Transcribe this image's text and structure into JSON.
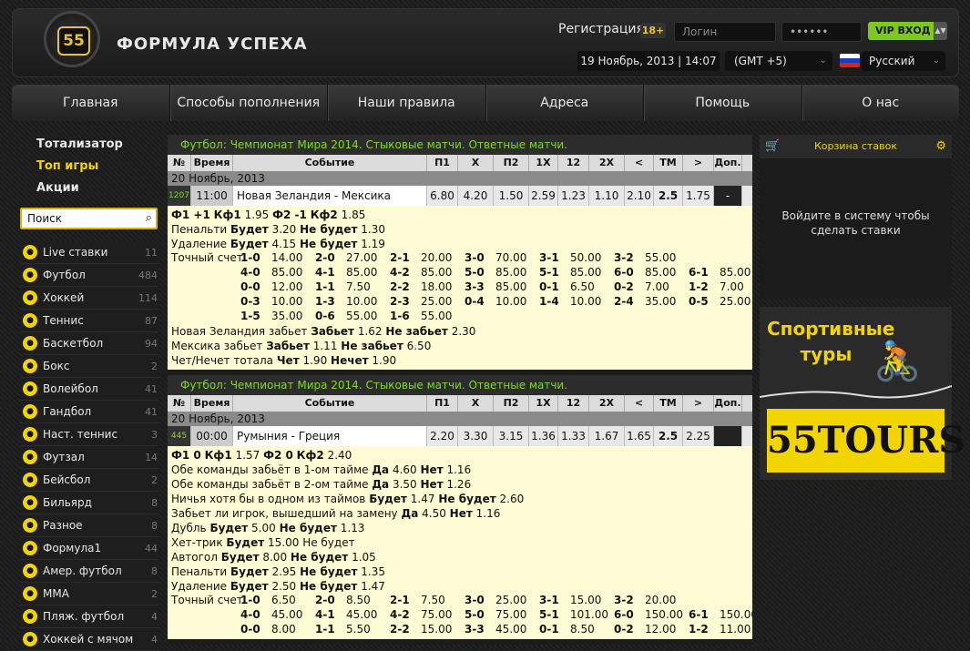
{
  "header": {
    "logo_number": "55",
    "logo_text": "ФОРМУЛА УСПЕХА",
    "register": "Регистрация",
    "age_badge": "18+",
    "login_placeholder": "Логин",
    "password_value": "••••••",
    "vip_label": "VIP ВХОД",
    "datetime": "19 Ноябрь, 2013 | 14:07",
    "timezone": "(GMT +5)",
    "language": "Русский",
    "accent": "#f2d400",
    "green": "#7ddc24"
  },
  "nav": [
    "Главная",
    "Способы пополнения",
    "Наши правила",
    "Адреса",
    "Помощь",
    "О нас"
  ],
  "sidebar": {
    "top": [
      "Тотализатор",
      "Топ игры",
      "Акции"
    ],
    "search_placeholder": "Поиск",
    "sports": [
      {
        "name": "Live ставки",
        "count": "11"
      },
      {
        "name": "Футбол",
        "count": "484"
      },
      {
        "name": "Хоккей",
        "count": "114"
      },
      {
        "name": "Теннис",
        "count": "87"
      },
      {
        "name": "Баскетбол",
        "count": "94"
      },
      {
        "name": "Бокс",
        "count": "2"
      },
      {
        "name": "Волейбол",
        "count": "41"
      },
      {
        "name": "Гандбол",
        "count": "41"
      },
      {
        "name": "Наст. теннис",
        "count": "3"
      },
      {
        "name": "Футзал",
        "count": "14"
      },
      {
        "name": "Бейсбол",
        "count": "2"
      },
      {
        "name": "Бильярд",
        "count": "8"
      },
      {
        "name": "Разное",
        "count": "8"
      },
      {
        "name": "Формула1",
        "count": "44"
      },
      {
        "name": "Амер. футбол",
        "count": "8"
      },
      {
        "name": "MMA",
        "count": "2"
      },
      {
        "name": "Пляж. футбол",
        "count": "4"
      },
      {
        "name": "Хоккей с мячом",
        "count": "4"
      }
    ]
  },
  "table_headers": [
    "№",
    "Время",
    "Событие",
    "П1",
    "Х",
    "П2",
    "1Х",
    "12",
    "2Х",
    "<",
    "ТМ",
    ">",
    "Доп."
  ],
  "matches": [
    {
      "section": "Футбол: Чемпионат Мира 2014. Стыковые матчи. Ответные матчи.",
      "date": "20 Ноябрь, 2013",
      "id": "1207",
      "time": "11:00",
      "event": "Новая Зеландия - Мексика",
      "odds": [
        "6.80",
        "4.20",
        "1.50",
        "2.59",
        "1.23",
        "1.10",
        "2.10",
        "2.5",
        "1.75"
      ],
      "extra": "-",
      "lines": [
        [
          [
            "Ф1 +1",
            true
          ],
          [
            "Кф1",
            true
          ],
          [
            "1.95",
            false
          ],
          [
            "Ф2 -1",
            true
          ],
          [
            "Кф2",
            true
          ],
          [
            "1.85",
            false
          ]
        ],
        [
          [
            "Пенальти",
            false
          ],
          [
            "Будет",
            true
          ],
          [
            "3.20",
            false
          ],
          [
            "Не будет",
            true
          ],
          [
            "1.30",
            false
          ]
        ],
        [
          [
            "Удаление",
            false
          ],
          [
            "Будет",
            true
          ],
          [
            "4.15",
            false
          ],
          [
            "Не будет",
            true
          ],
          [
            "1.19",
            false
          ]
        ]
      ],
      "score_label": "Точный счет",
      "score_rows": [
        [
          [
            "1-0",
            "14.00"
          ],
          [
            "2-0",
            "27.00"
          ],
          [
            "2-1",
            "20.00"
          ],
          [
            "3-0",
            "70.00"
          ],
          [
            "3-1",
            "50.00"
          ],
          [
            "3-2",
            "55.00"
          ]
        ],
        [
          [
            "4-0",
            "85.00"
          ],
          [
            "4-1",
            "85.00"
          ],
          [
            "4-2",
            "85.00"
          ],
          [
            "5-0",
            "85.00"
          ],
          [
            "5-1",
            "85.00"
          ],
          [
            "6-0",
            "85.00"
          ],
          [
            "6-1",
            "85.00"
          ]
        ],
        [
          [
            "0-0",
            "12.00"
          ],
          [
            "1-1",
            "7.50"
          ],
          [
            "2-2",
            "18.00"
          ],
          [
            "3-3",
            "85.00"
          ],
          [
            "0-1",
            "6.50"
          ],
          [
            "0-2",
            "7.00"
          ],
          [
            "1-2",
            "7.00"
          ]
        ],
        [
          [
            "0-3",
            "10.00"
          ],
          [
            "1-3",
            "10.00"
          ],
          [
            "2-3",
            "25.00"
          ],
          [
            "0-4",
            "10.00"
          ],
          [
            "1-4",
            "10.00"
          ],
          [
            "2-4",
            "35.00"
          ],
          [
            "0-5",
            "25.00"
          ]
        ],
        [
          [
            "1-5",
            "35.00"
          ],
          [
            "0-6",
            "55.00"
          ],
          [
            "1-6",
            "55.00"
          ]
        ]
      ],
      "tail_lines": [
        [
          [
            "Новая Зеландия забьет",
            false
          ],
          [
            "Забьет",
            true
          ],
          [
            "1.62",
            false
          ],
          [
            "Не забьет",
            true
          ],
          [
            "2.30",
            false
          ]
        ],
        [
          [
            "Мексика забьет",
            false
          ],
          [
            "Забьет",
            true
          ],
          [
            "1.11",
            false
          ],
          [
            "Не забьет",
            true
          ],
          [
            "6.50",
            false
          ]
        ],
        [
          [
            "Чет/Нечет тотала",
            false
          ],
          [
            "Чет",
            true
          ],
          [
            "1.90",
            false
          ],
          [
            "Нечет",
            true
          ],
          [
            "1.90",
            false
          ]
        ]
      ]
    },
    {
      "section": "Футбол: Чемпионат Мира 2014. Стыковые матчи. Ответные матчи.",
      "date": "20 Ноябрь, 2013",
      "id": "445",
      "time": "00:00",
      "event": "Румыния - Греция",
      "odds": [
        "2.20",
        "3.30",
        "3.15",
        "1.36",
        "1.33",
        "1.67",
        "1.65",
        "2.5",
        "2.25"
      ],
      "extra": "",
      "lines": [
        [
          [
            "Ф1 0",
            true
          ],
          [
            "Кф1",
            true
          ],
          [
            "1.57",
            false
          ],
          [
            "Ф2 0",
            true
          ],
          [
            "Кф2",
            true
          ],
          [
            "2.40",
            false
          ]
        ],
        [
          [
            "Обе команды забьёт в 1-ом тайме",
            false
          ],
          [
            "Да",
            true
          ],
          [
            "4.60",
            false
          ],
          [
            "Нет",
            true
          ],
          [
            "1.16",
            false
          ]
        ],
        [
          [
            "Обе команды забьёт в 2-ом тайме",
            false
          ],
          [
            "Да",
            true
          ],
          [
            "3.50",
            false
          ],
          [
            "Нет",
            true
          ],
          [
            "1.26",
            false
          ]
        ],
        [
          [
            "Ничья хотя бы в одном из таймов",
            false
          ],
          [
            "Будет",
            true
          ],
          [
            "1.47",
            false
          ],
          [
            "Не будет",
            true
          ],
          [
            "2.60",
            false
          ]
        ],
        [
          [
            "Забьет ли игрок, вышедший на замену",
            false
          ],
          [
            "Да",
            true
          ],
          [
            "4.50",
            false
          ],
          [
            "Нет",
            true
          ],
          [
            "1.16",
            false
          ]
        ],
        [
          [
            "Дубль",
            false
          ],
          [
            "Будет",
            true
          ],
          [
            "5.00",
            false
          ],
          [
            "Не будет",
            true
          ],
          [
            "1.13",
            false
          ]
        ],
        [
          [
            "Хет-трик",
            false
          ],
          [
            "Будет",
            true
          ],
          [
            "15.00",
            false
          ],
          [
            "Не будет",
            false
          ]
        ],
        [
          [
            "Автогол",
            false
          ],
          [
            "Будет",
            true
          ],
          [
            "8.00",
            false
          ],
          [
            "Не будет",
            true
          ],
          [
            "1.05",
            false
          ]
        ],
        [
          [
            "Пенальти",
            false
          ],
          [
            "Будет",
            true
          ],
          [
            "2.95",
            false
          ],
          [
            "Не будет",
            true
          ],
          [
            "1.35",
            false
          ]
        ],
        [
          [
            "Удаление",
            false
          ],
          [
            "Будет",
            true
          ],
          [
            "2.50",
            false
          ],
          [
            "Не будет",
            true
          ],
          [
            "1.47",
            false
          ]
        ]
      ],
      "score_label": "Точный счет",
      "score_rows": [
        [
          [
            "1-0",
            "6.50"
          ],
          [
            "2-0",
            "8.50"
          ],
          [
            "2-1",
            "7.50"
          ],
          [
            "3-0",
            "25.00"
          ],
          [
            "3-1",
            "15.00"
          ],
          [
            "3-2",
            "20.00"
          ]
        ],
        [
          [
            "4-0",
            "45.00"
          ],
          [
            "4-1",
            "45.00"
          ],
          [
            "4-2",
            "75.00"
          ],
          [
            "5-0",
            "75.00"
          ],
          [
            "5-1",
            "101.00"
          ],
          [
            "6-0",
            "150.00"
          ],
          [
            "6-1",
            "150.00"
          ]
        ],
        [
          [
            "0-0",
            "8.00"
          ],
          [
            "1-1",
            "5.50"
          ],
          [
            "2-2",
            "15.00"
          ],
          [
            "3-3",
            "45.00"
          ],
          [
            "0-1",
            "8.50"
          ],
          [
            "0-2",
            "12.00"
          ],
          [
            "1-2",
            "11.00"
          ]
        ]
      ],
      "tail_lines": []
    }
  ],
  "cart": {
    "title": "Корзина ставок",
    "message": "Войдите в систему чтобы сделать ставки"
  },
  "promo": {
    "title": "Спортивные туры",
    "brand": "55TOURS"
  }
}
